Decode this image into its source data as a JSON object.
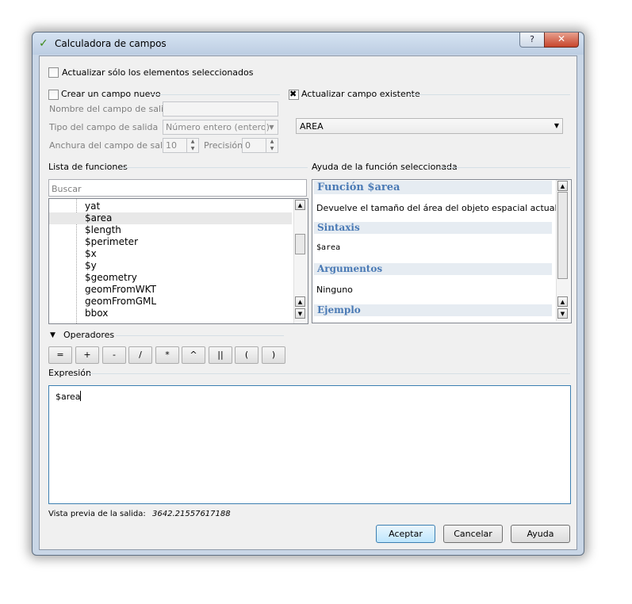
{
  "window": {
    "title": "Calculadora de campos",
    "help_glyph": "?",
    "close_glyph": "✕",
    "icon": "qgis-calculator-icon"
  },
  "top": {
    "update_selected_label": "Actualizar sólo los elementos seleccionados"
  },
  "new_field": {
    "checkbox_label": "Crear un campo nuevo",
    "name_label": "Nombre del campo de salida",
    "name_value": "",
    "type_label": "Tipo del campo de salida",
    "type_value": "Número entero (entero)",
    "width_label": "Anchura del campo de salida",
    "width_value": "10",
    "precision_label": "Precisión",
    "precision_value": "0"
  },
  "existing_field": {
    "checkbox_label": "Actualizar campo existente",
    "selected": "AREA"
  },
  "functions": {
    "section_label": "Lista de funciones",
    "search_placeholder": "Buscar",
    "items": [
      "yat",
      "$area",
      "$length",
      "$perimeter",
      "$x",
      "$y",
      "$geometry",
      "geomFromWKT",
      "geomFromGML",
      "bbox"
    ],
    "selected": "$area"
  },
  "help": {
    "section_label": "Ayuda de la función seleccionada",
    "title": "Función $area",
    "description": "Devuelve el tamaño del área del objeto espacial actual.",
    "syntax_heading": "Sintaxis",
    "syntax": "$area",
    "arguments_heading": "Argumentos",
    "arguments": "Ninguno",
    "example_heading": "Ejemplo"
  },
  "operators": {
    "label": "Operadores",
    "buttons": [
      "=",
      "+",
      "-",
      "/",
      "*",
      "^",
      "||",
      "(",
      ")"
    ]
  },
  "expression": {
    "label": "Expresión",
    "value": "$area"
  },
  "preview": {
    "label": "Vista previa de la salida:",
    "value": "3642.21557617188"
  },
  "buttons": {
    "accept": "Aceptar",
    "cancel": "Cancelar",
    "help": "Ayuda"
  },
  "colors": {
    "accent": "#3c7fb1",
    "help_heading": "#4a7ab5",
    "close_button": "#c7452c"
  }
}
